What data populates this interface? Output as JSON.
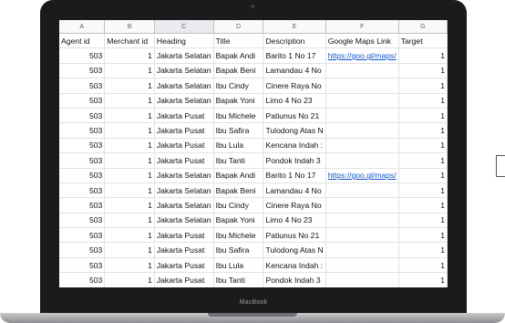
{
  "device": {
    "brand_label": "MacBook"
  },
  "spreadsheet": {
    "column_letters": [
      "A",
      "B",
      "C",
      "D",
      "E",
      "F",
      "G"
    ],
    "headers": [
      "Agent id",
      "Merchant id",
      "Heading",
      "Title",
      "Description",
      "Google Maps Link",
      "Target"
    ],
    "rows": [
      [
        "503",
        "1",
        "Jakarta Selatan",
        "Bapak Andi",
        "Barito 1 No 17",
        "https://goo.gl/maps/",
        "1"
      ],
      [
        "503",
        "1",
        "Jakarta Selatan",
        "Bapak Beni",
        "Lamandau 4 No",
        "",
        "1"
      ],
      [
        "503",
        "1",
        "Jakarta Selatan",
        "Ibu Cindy",
        "Cinere Raya No",
        "",
        "1"
      ],
      [
        "503",
        "1",
        "Jakarta Selatan",
        "Bapak Yoni",
        "Limo 4 No 23",
        "",
        "1"
      ],
      [
        "503",
        "1",
        "Jakarta Pusat",
        "Ibu Michele",
        "Patiunus No 21",
        "",
        "1"
      ],
      [
        "503",
        "1",
        "Jakarta Pusat",
        "Ibu Safira",
        "Tulodong Atas N",
        "",
        "1"
      ],
      [
        "503",
        "1",
        "Jakarta Pusat",
        "Ibu Lula",
        "Kencana Indah :",
        "",
        "1"
      ],
      [
        "503",
        "1",
        "Jakarta Pusat",
        "Ibu Tanti",
        "Pondok Indah 3",
        "",
        "1"
      ],
      [
        "503",
        "1",
        "Jakarta Selatan",
        "Bapak Andi",
        "Barito 1 No 17",
        "https://goo.gl/maps/",
        "1"
      ],
      [
        "503",
        "1",
        "Jakarta Selatan",
        "Bapak Beni",
        "Lamandau 4 No",
        "",
        "1"
      ],
      [
        "503",
        "1",
        "Jakarta Selatan",
        "Ibu Cindy",
        "Cinere Raya No",
        "",
        "1"
      ],
      [
        "503",
        "1",
        "Jakarta Selatan",
        "Bapak Yoni",
        "Limo 4 No 23",
        "",
        "1"
      ],
      [
        "503",
        "1",
        "Jakarta Pusat",
        "Ibu Michele",
        "Patiunus No 21",
        "",
        "1"
      ],
      [
        "503",
        "1",
        "Jakarta Pusat",
        "Ibu Safira",
        "Tulodong Atas N",
        "",
        "1"
      ],
      [
        "503",
        "1",
        "Jakarta Pusat",
        "Ibu Lula",
        "Kencana Indah :",
        "",
        "1"
      ],
      [
        "503",
        "1",
        "Jakarta Pusat",
        "Ibu Tanti",
        "Pondok Indah 3",
        "",
        "1"
      ]
    ]
  }
}
